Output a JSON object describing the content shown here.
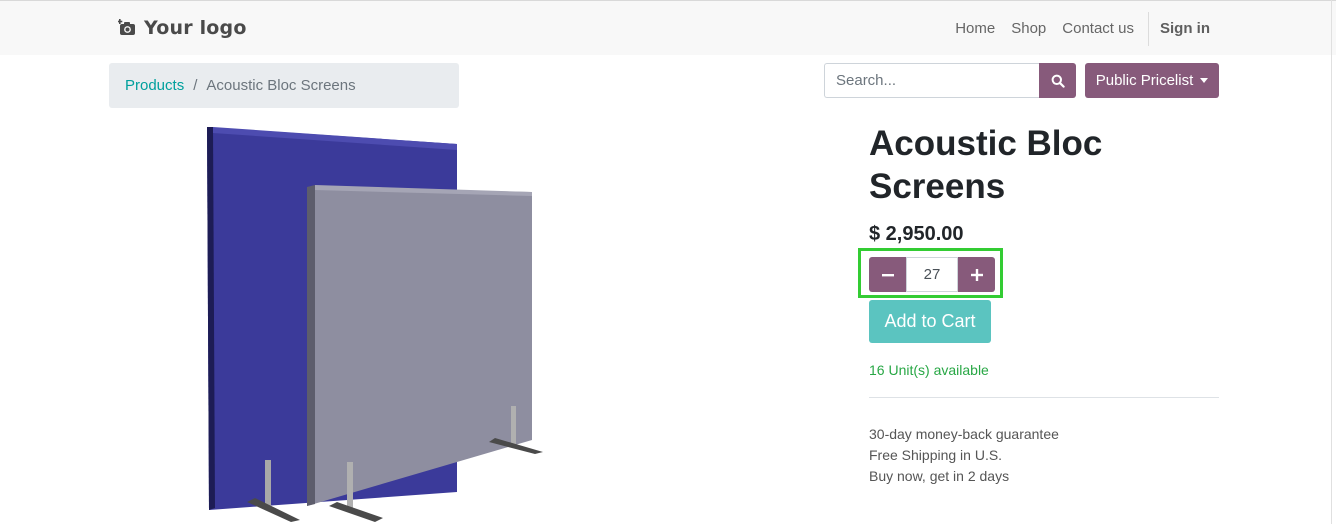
{
  "header": {
    "logo_text": "Your logo",
    "logo_icon": "camera-plus-icon",
    "nav": [
      "Home",
      "Shop",
      "Contact us"
    ],
    "sign_in": "Sign in"
  },
  "breadcrumb": {
    "parent": "Products",
    "separator": "/",
    "current": "Acoustic Bloc Screens"
  },
  "search": {
    "placeholder": "Search...",
    "value": "",
    "icon": "search-icon"
  },
  "pricelist": {
    "label": "Public Pricelist"
  },
  "product": {
    "title": "Acoustic Bloc Screens",
    "price": "$ 2,950.00",
    "quantity": "27",
    "add_to_cart": "Add to Cart",
    "availability": "16 Unit(s) available",
    "perks": [
      "30-day money-back guarantee",
      "Free Shipping in U.S.",
      "Buy now, get in 2 days"
    ]
  },
  "colors": {
    "primary": "#875a7b",
    "link": "#00a09d",
    "cart_button": "#5bc4c0",
    "available": "#28a745",
    "highlight": "#33cc33"
  }
}
